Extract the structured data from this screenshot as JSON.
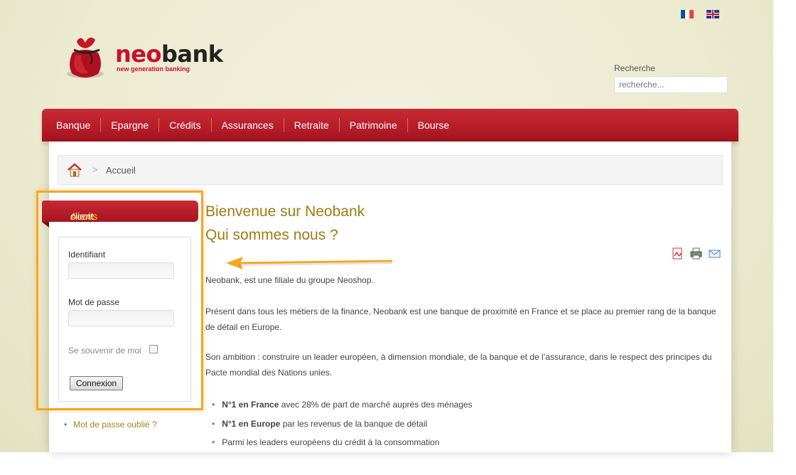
{
  "languages": [
    {
      "code": "fr",
      "icon": "flag-france-icon"
    },
    {
      "code": "en",
      "icon": "flag-uk-icon"
    }
  ],
  "logo": {
    "brand_neo": "neo",
    "brand_bank": "bank",
    "tagline": "new generation banking"
  },
  "search": {
    "label": "Recherche",
    "placeholder": "recherche..."
  },
  "nav": {
    "items": [
      "Banque",
      "Epargne",
      "Crédits",
      "Assurances",
      "Retraite",
      "Patrimoine",
      "Bourse"
    ]
  },
  "breadcrumb": {
    "separator": ">",
    "current": "Accueil"
  },
  "login": {
    "title_highlight": "Accès",
    "title_rest": " client",
    "username_label": "Identifiant",
    "password_label": "Mot de passe",
    "remember_label": "Se souvenir de moi",
    "remember_checked": false,
    "submit_label": "Connexion",
    "forgot_link": "Mot de passe oublié ?"
  },
  "article": {
    "title_line1": "Bienvenue sur Neobank",
    "title_line2": "Qui sommes nous ?",
    "paragraphs": [
      "Neobank, est une filiale du groupe Neoshop.",
      "Présent dans tous les métiers de la finance, Neobank est une banque de proximité en France et se place au premier rang de la banque de détail en Europe.",
      "Son ambition : construire un leader européen, à dimension mondiale, de la banque et de l’assurance, dans le respect des principes du Pacte mondial des Nations unies."
    ],
    "bullets": [
      {
        "bold": "N°1 en France",
        "text": " avec 28% de part de marché auprès des ménages"
      },
      {
        "bold": "N°1 en Europe",
        "text": " par les revenus de la banque de détail"
      },
      {
        "bold": "",
        "text": "Parmi les leaders européens du crédit à la consommation"
      }
    ],
    "tools": [
      "pdf-icon",
      "print-icon",
      "email-icon"
    ]
  },
  "colors": {
    "brand_red": "#c8102e",
    "nav_red": "#b41c27",
    "title_gold": "#a07c12",
    "highlight_orange": "#f5a623",
    "background": "#eceacf"
  }
}
